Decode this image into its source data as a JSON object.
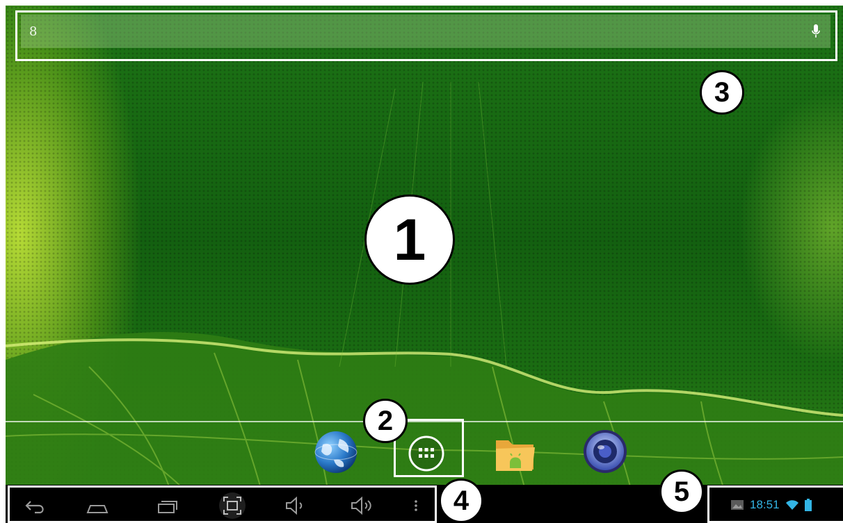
{
  "search": {
    "google_glyph": "8"
  },
  "callouts": {
    "c1": "1",
    "c2": "2",
    "c3": "3",
    "c4": "4",
    "c5": "5"
  },
  "status_bar": {
    "time": "18:51"
  },
  "icons": {
    "search_bar": [
      "google-icon",
      "microphone-icon"
    ],
    "dock": [
      "browser-globe-icon",
      "all-apps-icon",
      "file-manager-icon",
      "music-player-icon"
    ],
    "navigation": [
      "back-icon",
      "home-icon",
      "recent-apps-icon",
      "screenshot-icon",
      "volume-down-icon",
      "volume-up-icon",
      "menu-icon"
    ],
    "status": [
      "gallery-notification-icon",
      "wifi-icon",
      "battery-icon"
    ]
  },
  "colors": {
    "callout_border": "#000000",
    "highlight_frame": "#ffffff",
    "clock_text": "#33b5e5",
    "navbar_bg": "#000000",
    "wallpaper_green": "#136010"
  }
}
